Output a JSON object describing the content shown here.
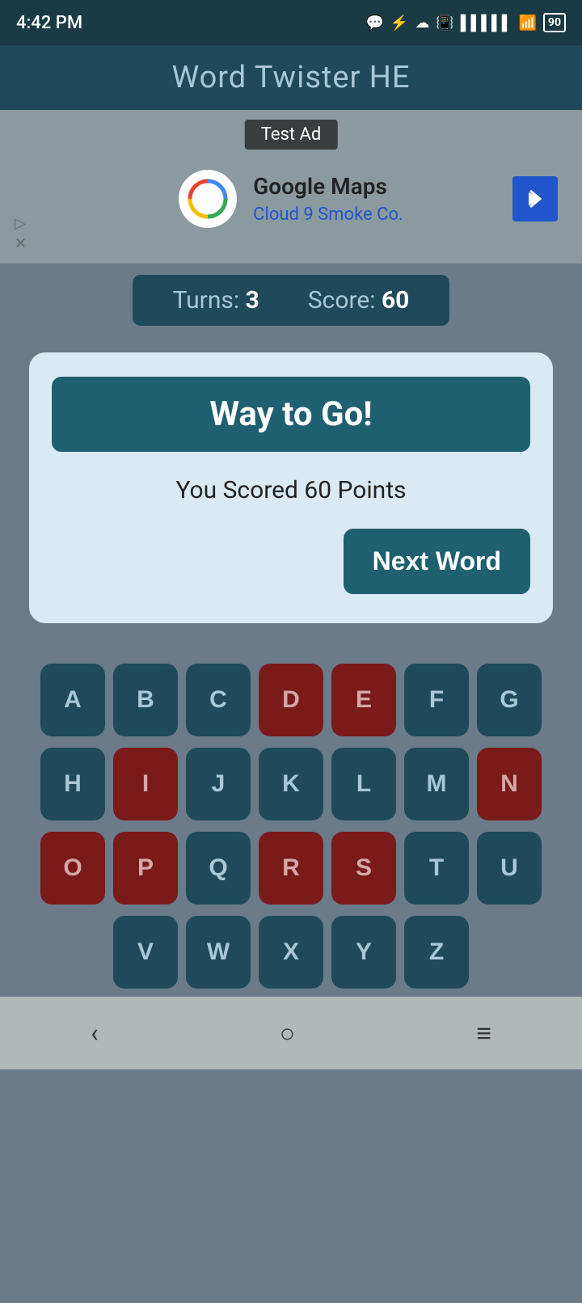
{
  "statusBar": {
    "time": "4:42 PM",
    "battery": "90"
  },
  "header": {
    "title": "Word Twister HE"
  },
  "ad": {
    "label": "Test Ad",
    "company": "Google Maps",
    "subtext": "Cloud 9 Smoke Co."
  },
  "score": {
    "turnsLabel": "Turns:",
    "turnsValue": "3",
    "scoreLabel": "Score:",
    "scoreValue": "60"
  },
  "modal": {
    "headerText": "Way to Go!",
    "scoreText": "You Scored 60 Points",
    "nextWordLabel": "Next Word"
  },
  "keyboard": {
    "rows": [
      [
        {
          "letter": "A",
          "used": false
        },
        {
          "letter": "B",
          "used": false
        },
        {
          "letter": "C",
          "used": false
        },
        {
          "letter": "D",
          "used": true
        },
        {
          "letter": "E",
          "used": true
        },
        {
          "letter": "F",
          "used": false
        },
        {
          "letter": "G",
          "used": false
        }
      ],
      [
        {
          "letter": "H",
          "used": false
        },
        {
          "letter": "I",
          "used": true
        },
        {
          "letter": "J",
          "used": false
        },
        {
          "letter": "K",
          "used": false
        },
        {
          "letter": "L",
          "used": false
        },
        {
          "letter": "M",
          "used": false
        },
        {
          "letter": "N",
          "used": true
        }
      ],
      [
        {
          "letter": "O",
          "used": true
        },
        {
          "letter": "P",
          "used": true
        },
        {
          "letter": "Q",
          "used": false
        },
        {
          "letter": "R",
          "used": true
        },
        {
          "letter": "S",
          "used": true
        },
        {
          "letter": "T",
          "used": false
        },
        {
          "letter": "U",
          "used": false
        }
      ],
      [
        {
          "letter": "V",
          "used": false
        },
        {
          "letter": "W",
          "used": false
        },
        {
          "letter": "X",
          "used": false
        },
        {
          "letter": "Y",
          "used": false
        },
        {
          "letter": "Z",
          "used": false
        }
      ]
    ]
  },
  "navBar": {
    "backIcon": "‹",
    "homeIcon": "○",
    "menuIcon": "≡"
  }
}
